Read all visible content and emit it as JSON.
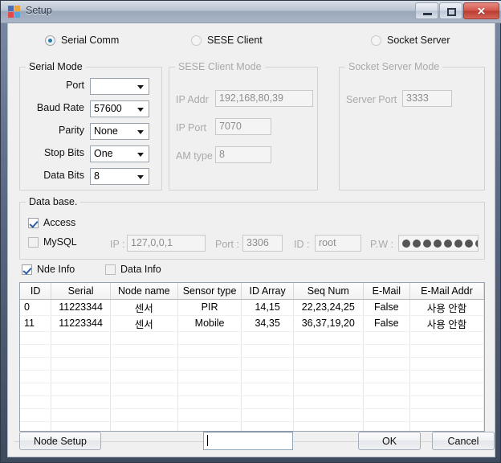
{
  "window": {
    "title": "Setup",
    "ghost_title": "",
    "controls": {
      "minimize": "Minimize",
      "maximize": "Maximize",
      "close": "Close"
    }
  },
  "mode_radios": [
    {
      "label": "Serial Comm",
      "selected": true,
      "enabled": true
    },
    {
      "label": "SESE Client",
      "selected": false,
      "enabled": false
    },
    {
      "label": "Socket Server",
      "selected": false,
      "enabled": false
    }
  ],
  "serial_mode": {
    "caption": "Serial Mode",
    "fields": [
      {
        "label": "Port",
        "value": ""
      },
      {
        "label": "Baud Rate",
        "value": "57600"
      },
      {
        "label": "Parity",
        "value": "None"
      },
      {
        "label": "Stop Bits",
        "value": "One"
      },
      {
        "label": "Data Bits",
        "value": "8"
      }
    ]
  },
  "sese_client_mode": {
    "caption": "SESE Client Mode",
    "fields": [
      {
        "label": "IP Addr",
        "value": "192,168,80,39"
      },
      {
        "label": "IP Port",
        "value": "7070"
      },
      {
        "label": "AM type",
        "value": "8"
      }
    ]
  },
  "socket_server_mode": {
    "caption": "Socket Server Mode",
    "fields": [
      {
        "label": "Server Port",
        "value": "3333"
      }
    ]
  },
  "database": {
    "caption": "Data base.",
    "access": {
      "label": "Access",
      "checked": true
    },
    "mysql": {
      "label": "MySQL",
      "checked": false
    },
    "ip": {
      "label": "IP :",
      "value": "127,0,0,1"
    },
    "port": {
      "label": "Port :",
      "value": "3306"
    },
    "id": {
      "label": "ID :",
      "value": "root"
    },
    "pw": {
      "label": "P.W :",
      "value": "········",
      "dot_count": 8
    }
  },
  "info_checks": {
    "node_info": {
      "label": "Nde Info",
      "checked": true
    },
    "data_info": {
      "label": "Data Info",
      "checked": false
    }
  },
  "grid": {
    "columns": [
      "ID",
      "Serial",
      "Node name",
      "Sensor type",
      "ID Array",
      "Seq Num",
      "E-Mail",
      "E-Mail Addr"
    ],
    "rows": [
      {
        "id": "0",
        "serial": "11223344",
        "node_name": "센서",
        "sensor_type": "PIR",
        "id_array": "14,15",
        "seq_num": "22,23,24,25",
        "email": "False",
        "email_addr": "사용 안함"
      },
      {
        "id": "11",
        "serial": "11223344",
        "node_name": "센서",
        "sensor_type": "Mobile",
        "id_array": "34,35",
        "seq_num": "36,37,19,20",
        "email": "False",
        "email_addr": "사용 안함"
      }
    ],
    "blank_row_count": 8
  },
  "footer": {
    "node_setup_label": "Node Setup",
    "text_field_value": "",
    "ok_label": "OK",
    "cancel_label": "Cancel"
  }
}
